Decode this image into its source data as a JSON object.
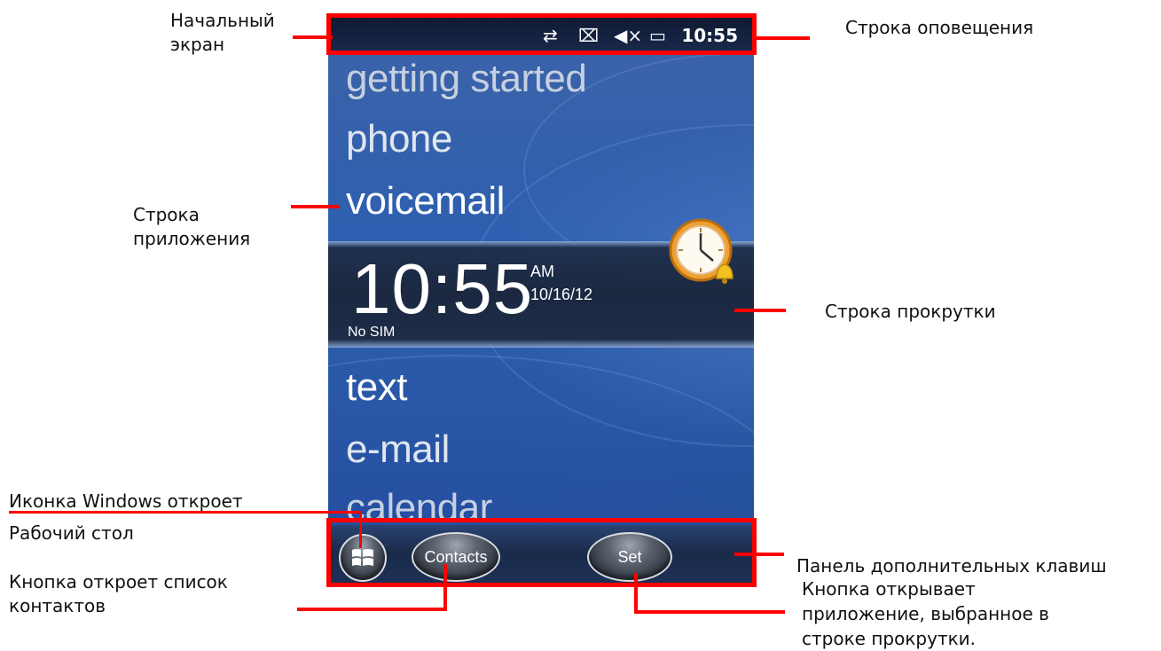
{
  "annotations": {
    "start_screen": [
      "Начальный",
      "экран"
    ],
    "notification_bar": "Строка оповещения",
    "app_line": [
      "Строка",
      "приложения"
    ],
    "scroll_line": "Строка прокрутки",
    "windows_icon": [
      "Иконка Windows откроет",
      "Рабочий стол"
    ],
    "contacts_btn": [
      "Кнопка откроет список",
      "контактов"
    ],
    "softkey_panel": "Панель дополнительных клавиш",
    "set_btn": [
      "Кнопка открывает",
      "приложение, выбранное в",
      "строке прокрутки."
    ]
  },
  "status_bar": {
    "icons": [
      "sync-icon",
      "no-sim-icon",
      "speaker-muted-icon",
      "battery-charging-icon"
    ],
    "time": "10:55"
  },
  "apps": [
    "getting started",
    "phone",
    "voicemail",
    "text",
    "e-mail",
    "calendar"
  ],
  "scroll": {
    "time": "10:55",
    "ampm": "AM",
    "date": "10/16/12",
    "sim": "No SIM"
  },
  "softkeys": {
    "contacts": "Contacts",
    "set": "Set"
  },
  "colors": {
    "accent_red": "#ff0000",
    "wallpaper_blue": "#2d5fb0"
  }
}
